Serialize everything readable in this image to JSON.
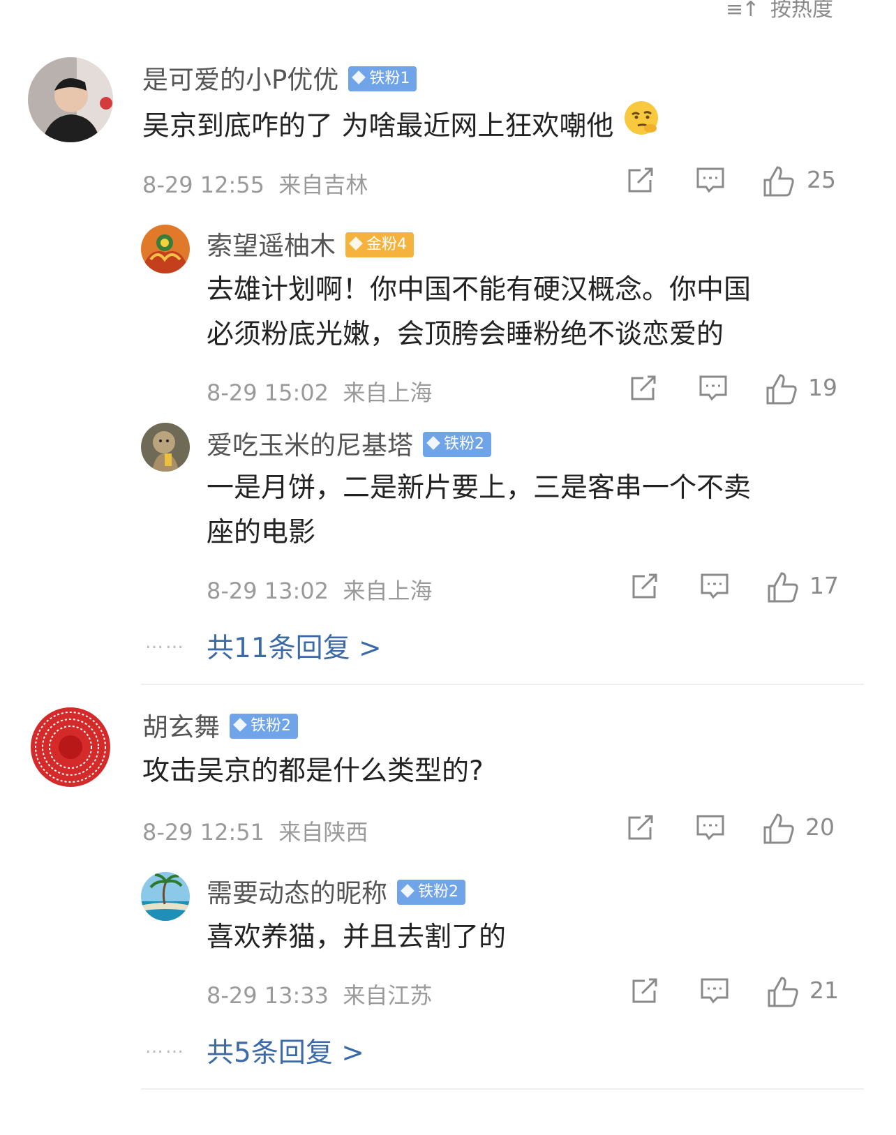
{
  "sort_label": "按热度",
  "comments": [
    {
      "name": "是可爱的小P优优",
      "badge": "铁粉1",
      "text": "吴京到底咋的了 为啥最近网上狂欢嘲他",
      "time": "8-29 12:55",
      "location": "来自吉林",
      "likes": "25",
      "replies": [
        {
          "name": "索望遥柚木",
          "badge": "金粉4",
          "text_line1": "去雄计划啊！你中国不能有硬汉概念。你中国",
          "text_line2": "必须粉底光嫩，会顶胯会睡粉绝不谈恋爱的",
          "time": "8-29 15:02",
          "location": "来自上海",
          "likes": "19"
        },
        {
          "name": "爱吃玉米的尼基塔",
          "badge": "铁粉2",
          "text_line1": "一是月饼，二是新片要上，三是客串一个不卖",
          "text_line2": "座的电影",
          "time": "8-29 13:02",
          "location": "来自上海",
          "likes": "17"
        }
      ],
      "more_replies": "共11条回复 >"
    },
    {
      "name": "胡玄舞",
      "badge": "铁粉2",
      "text": "攻击吴京的都是什么类型的?",
      "time": "8-29 12:51",
      "location": "来自陕西",
      "likes": "20",
      "replies": [
        {
          "name": "需要动态的昵称",
          "badge": "铁粉2",
          "text_line1": "喜欢养猫，并且去割了的",
          "time": "8-29 13:33",
          "location": "来自江苏",
          "likes": "21"
        }
      ],
      "more_replies": "共5条回复 >"
    }
  ],
  "icons": {
    "share": "share-icon",
    "comment": "comment-icon",
    "like": "like-icon"
  },
  "colors": {
    "iron_badge": "#6fa4e8",
    "gold_badge": "#f5b33d",
    "link": "#3c6aa8"
  }
}
